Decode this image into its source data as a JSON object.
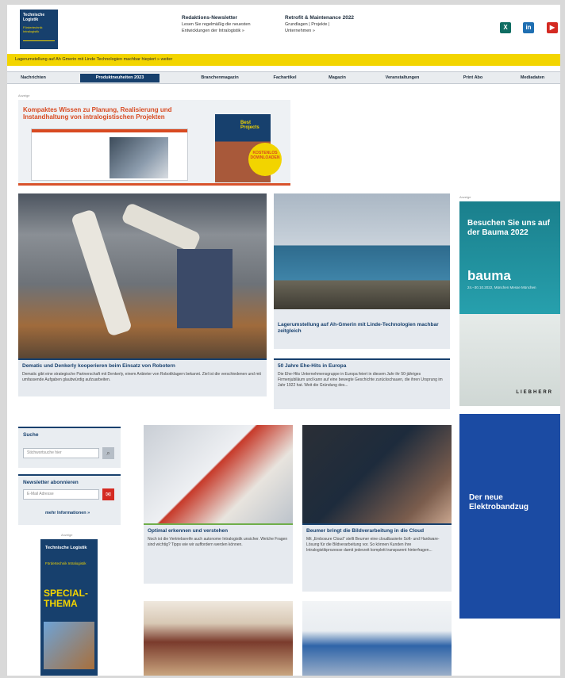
{
  "header": {
    "logo_line1": "Technische Logistik",
    "logo_line2": "Fördertechnik Intralogistik",
    "newsletter_title": "Redaktions-Newsletter",
    "newsletter_text1": "Lesen Sie regelmäßig die neuesten",
    "newsletter_text2": "Entwicklungen der Intralogistik »",
    "maintenance_title": "Retrofit & Maintenance 2022",
    "maintenance_text1": "Grundlagen | Projekte |",
    "maintenance_text2": "Unternehmen »",
    "social": [
      {
        "name": "xing",
        "glyph": "X",
        "color": "#0f6d62"
      },
      {
        "name": "linkedin",
        "glyph": "in",
        "color": "#1f6fb2"
      },
      {
        "name": "youtube",
        "glyph": "▶",
        "color": "#d42a22"
      }
    ]
  },
  "ticker": "Lagerumstellung auf Ah Gmerin mit Linde Technologien machbar hiepiert » weiter",
  "nav": [
    "Nachrichten",
    "Produktneuheiten 2023",
    "Branchenmagazin",
    "Fachartikel",
    "Magazin",
    "Veranstaltungen",
    "Print Abo",
    "Mediadaten"
  ],
  "ad_label": "Anzeige",
  "banner": {
    "title": "Kompaktes Wissen zu Planung, Realisierung und Instandhaltung von intralogistischen Projekten",
    "book_title": "Best Projects",
    "burst": "KOSTENLOS DOWNLOADEN"
  },
  "articles": {
    "robot": {
      "headline": "Dematic und Denkerly kooperieren beim Einsatz von Robotern",
      "text": "Dematic gibt eine strategische Partnerschaft mit Denkerly, einem Anbieter von Robotiklagern bekannt. Ziel ist die verschiedenen und mit umfassende Aufgaben glaubwürdig aufzuarbeiten."
    },
    "yard": {
      "headline": "Lagerumstellung auf Ah-Gmerin mit Linde-Technologien machbar zeitgleich"
    },
    "europe": {
      "headline": "50 Jahre Ehe-Hits in Europa",
      "text": "Die Ehe-Hits Unternehmensgruppe in Europa feiert in diesem Jahr ihr 50-jähriges Firmenjubiläum und kann auf eine bewegte Geschichte zurückschauen, die ihren Ursprung im Jahr 1922 hat. Weit die Gründung des..."
    },
    "brochure": {
      "headline": "Optimal erkennen und verstehen",
      "text": "Noch ist die Vertriebsreife auch autonome Intralogistik unsicher. Welche Fragen sind wichtig? Tipps wie wir auffordern werden können."
    },
    "tablet": {
      "headline": "Beumer bringt die Bildverarbeitung in die Cloud",
      "text": "Mit „Embosure Cloud“ stellt Beumer eine cloudbasierte Soft- und Hardware-Lösung für die Bildverarbeitung vor. So können Kunden ihre Intralogistikprozesse damit jederzeit komplett transparent hinterfragen..."
    }
  },
  "sidebar_ad": {
    "title": "Besuchen Sie uns auf der Bauma 2022",
    "logo": "bauma",
    "sub": "24.–30.10.2022, München Messe München",
    "brand": "LIEBHERR"
  },
  "blue_ad": {
    "title": "Der neue Elektrobandzug"
  },
  "search": {
    "title": "Suche",
    "placeholder": "Stichwortsuche hier"
  },
  "newsletter": {
    "title": "Newsletter abonnieren",
    "placeholder": "E-Mail Adresse",
    "more": "mehr Informationen »"
  },
  "special": {
    "line1": "Technische Logistik",
    "line2": "Fördertechnik Intralogistik",
    "special_text": "SPECIAL-THEMA"
  }
}
